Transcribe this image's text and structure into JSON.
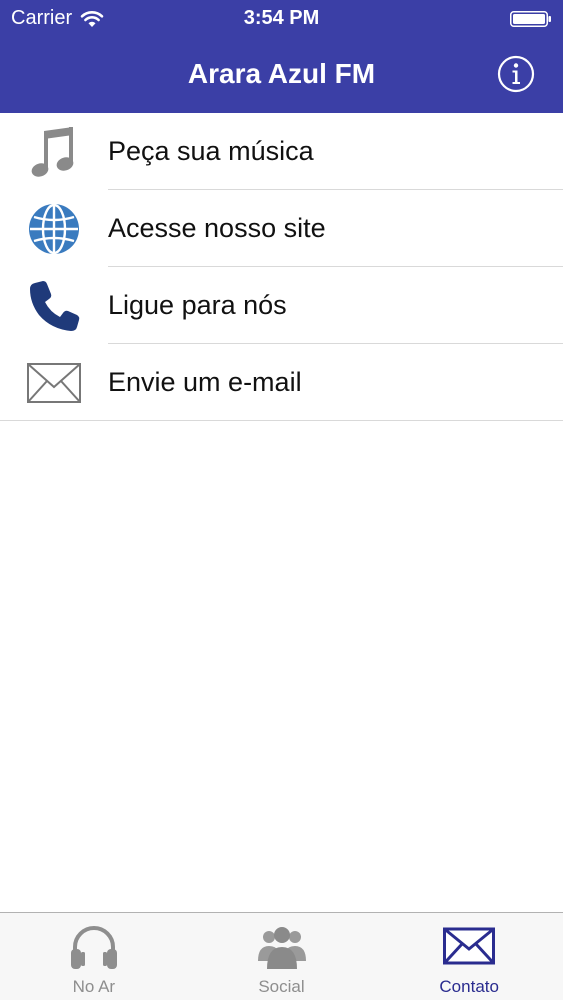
{
  "status_bar": {
    "carrier": "Carrier",
    "time": "3:54 PM"
  },
  "nav": {
    "title": "Arara Azul FM",
    "info_icon": "info-circle-icon"
  },
  "menu": {
    "items": [
      {
        "label": "Peça sua música",
        "icon": "music-note-icon"
      },
      {
        "label": "Acesse nosso site",
        "icon": "globe-icon"
      },
      {
        "label": "Ligue para nós",
        "icon": "phone-icon"
      },
      {
        "label": "Envie um e-mail",
        "icon": "envelope-icon"
      }
    ]
  },
  "tabs": [
    {
      "label": "No Ar",
      "icon": "headphones-icon",
      "active": false
    },
    {
      "label": "Social",
      "icon": "people-icon",
      "active": false
    },
    {
      "label": "Contato",
      "icon": "envelope-icon",
      "active": true
    }
  ],
  "colors": {
    "header_background": "#3b3fa6",
    "active_tab": "#2a2c8f",
    "inactive_tab": "#8e8e8e",
    "globe_blue": "#3a7bbf",
    "phone_navy": "#1f3a7a",
    "music_gray": "#8a8a8a"
  }
}
